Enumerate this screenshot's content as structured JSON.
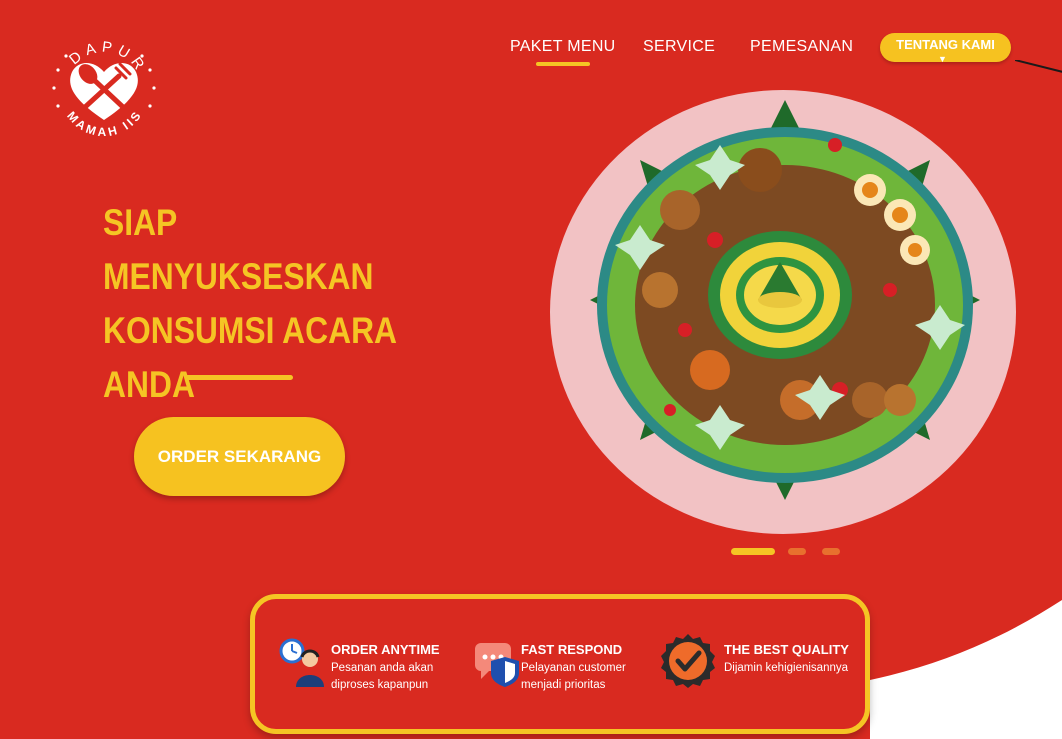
{
  "brand": {
    "logo_top_text": "DAPUR",
    "logo_bottom_text": "MAMAH IIS"
  },
  "nav": {
    "items": [
      "PAKET MENU",
      "SERVICE",
      "PEMESANAN"
    ],
    "active_index": 0,
    "pill_label": "TENTANG KAMI"
  },
  "hero": {
    "headline_lines": [
      "SIAP MENYUKSESKAN",
      "KONSUMSI ACARA",
      "ANDA"
    ],
    "cta_label": "ORDER SEKARANG"
  },
  "carousel": {
    "slides": 3,
    "active_index": 0
  },
  "features": [
    {
      "icon": "clock-person-icon",
      "title": "ORDER ANYTIME",
      "desc": "Pesanan anda akan diproses kapanpun"
    },
    {
      "icon": "chat-shield-icon",
      "title": "FAST RESPOND",
      "desc": "Pelayanan customer menjadi prioritas"
    },
    {
      "icon": "quality-badge-icon",
      "title": "THE BEST QUALITY",
      "desc": "Dijamin kehigienisannya"
    }
  ],
  "colors": {
    "primary_red": "#d92a20",
    "accent_yellow": "#f5c524",
    "pink_circle": "#f2c2c4"
  }
}
